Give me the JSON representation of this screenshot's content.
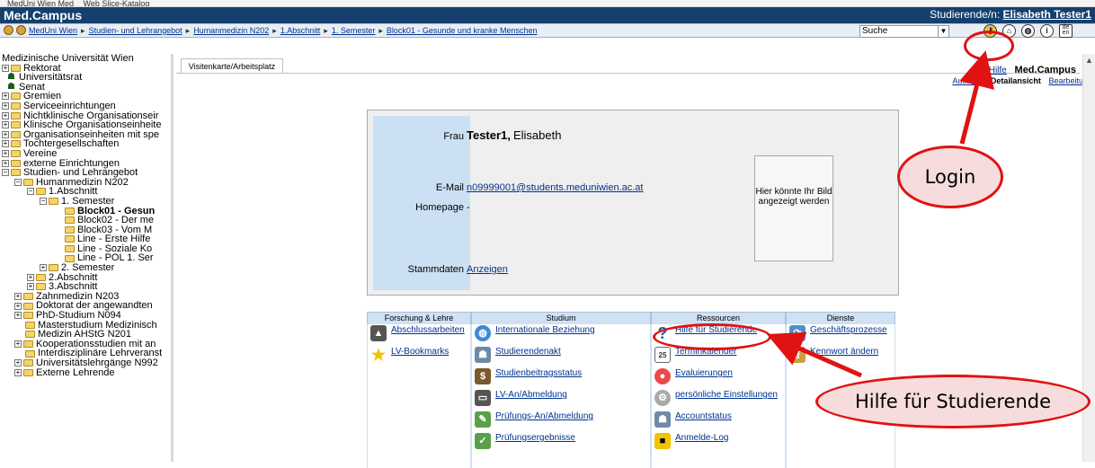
{
  "favorites_bar": {
    "items": [
      "MedUni Wien Med",
      "Web Slice-Katalog"
    ]
  },
  "header": {
    "title": "Med.Campus",
    "user_label": "Studierende/n:",
    "user_name": "Elisabeth Tester1"
  },
  "breadcrumb": [
    "MedUni Wien",
    "Studien- und Lehrangebot",
    "Humanmedizin N202",
    "1.Abschnitt",
    "1. Semester",
    "Block01 - Gesunde und kranke Menschen"
  ],
  "search": {
    "selected": "Suche"
  },
  "tools": {
    "lang_label": "de en"
  },
  "sidebar": {
    "root": "Medizinische Universität Wien",
    "items": [
      "Rektorat",
      "Universitätsrat",
      "Senat",
      "Gremien",
      "Serviceeinrichtungen",
      "Nichtklinische Organisationseir",
      "Klinische Organisationseinheite",
      "Organisationseinheiten mit spe",
      "Tochtergesellschaften",
      "Vereine",
      "externe Einrichtungen",
      "Studien- und Lehrangebot",
      "Humanmedizin N202",
      "1.Abschnitt",
      "1. Semester",
      "Block01 - Gesun",
      "Block02 - Der me",
      "Block03 - Vom M",
      "Line - Erste Hilfe",
      "Line - Soziale Ko",
      "Line - POL 1. Ser",
      "2. Semester",
      "2.Abschnitt",
      "3.Abschnitt",
      "Zahnmedizin N203",
      "Doktorat der angewandten",
      "PhD-Studium N094",
      "Masterstudium Medizinisch",
      "Medizin AHStG N201",
      "Kooperationsstudien mit an",
      "Interdisziplinäre Lehrveranst",
      "Universitätslehrgänge N992",
      "Externe Lehrende"
    ]
  },
  "main": {
    "tab": "Visitenkarte/Arbeitsplatz",
    "help_link": "Hilfe",
    "brand": "Med.Campus",
    "subnav": [
      "Auswahl",
      "Detailansicht",
      "Bearbeitung"
    ]
  },
  "card": {
    "salutation": "Frau",
    "name": "Tester1,",
    "firstname": "Elisabeth",
    "email_label": "E-Mail",
    "email": "n09999001@students.meduniwien.ac.at",
    "homepage_label": "Homepage",
    "homepage": "-",
    "photo_text": "Hier könnte Ihr Bild angezeigt werden",
    "stammdaten_label": "Stammdaten",
    "stammdaten_link": "Anzeigen"
  },
  "grid": {
    "columns": [
      {
        "title": "Forschung & Lehre",
        "items": [
          "Abschlussarbeiten",
          "LV-Bookmarks"
        ]
      },
      {
        "title": "Studium",
        "items": [
          "Internationale Beziehung",
          "Studierendenakt",
          "Studienbeitragsstatus",
          "LV-An/Abmeldung",
          "Prüfungs-An/Abmeldung",
          "Prüfungsergebnisse"
        ]
      },
      {
        "title": "Ressourcen",
        "items": [
          "Hilfe für Studierende",
          "Terminkalender",
          "Evaluierungen",
          "persönliche Einstellungen",
          "Accountstatus",
          "Anmelde-Log"
        ]
      },
      {
        "title": "Dienste",
        "items": [
          "Geschäftsprozesse",
          "Kennwort ändern"
        ]
      }
    ]
  },
  "annotations": {
    "login": "Login",
    "help": "Hilfe für Studierende"
  },
  "colors": {
    "title_bar": "#15406e",
    "accent_red": "#e01212",
    "column_header": "#cfe1f3",
    "card_side": "#cbe0f2"
  }
}
